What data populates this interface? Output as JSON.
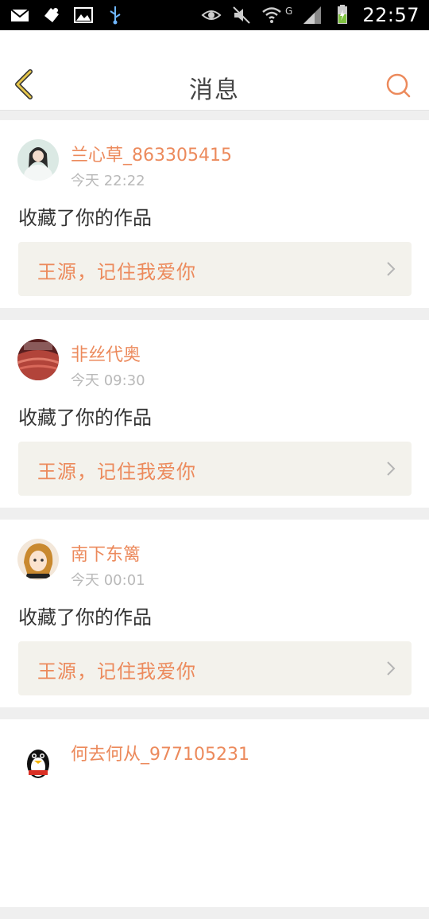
{
  "status_bar": {
    "left_icons": [
      "mail-icon",
      "app-icon",
      "image-icon",
      "usb-icon"
    ],
    "right_icons": [
      "eye-icon",
      "mute-icon",
      "wifi-icon",
      "network-g-icon",
      "signal-icon",
      "battery-icon"
    ],
    "network_label": "G",
    "time": "22:57"
  },
  "header": {
    "title": "消息",
    "back_icon": "chevron-left-icon",
    "search_icon": "search-icon"
  },
  "colors": {
    "accent": "#ec8a5c",
    "back_icon": "#e6c64b",
    "timestamp": "#b9b9b9",
    "work_bg": "#f3f2ec"
  },
  "messages": [
    {
      "user": "兰心草_863305415",
      "time": "今天 22:22",
      "action": "收藏了你的作品",
      "work_title": "王源，记住我爱你",
      "avatar": "avatar-fairy"
    },
    {
      "user": "非丝代奥",
      "time": "今天 09:30",
      "action": "收藏了你的作品",
      "work_title": "王源，记住我爱你",
      "avatar": "avatar-crowd"
    },
    {
      "user": "南下东篱",
      "time": "今天 00:01",
      "action": "收藏了你的作品",
      "work_title": "王源，记住我爱你",
      "avatar": "avatar-anime"
    },
    {
      "user": "何去何从_977105231",
      "time": "",
      "action": "",
      "work_title": "",
      "avatar": "avatar-penguin"
    }
  ]
}
